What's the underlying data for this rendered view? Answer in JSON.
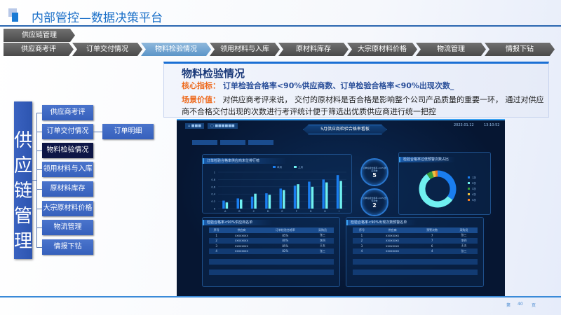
{
  "header": {
    "title": "内部管控—数据决策平台"
  },
  "breadcrumb": {
    "root": "供应链管理",
    "steps": [
      "供应商考评",
      "订单交付情况",
      "物料检验情况",
      "领用材料与入库",
      "原材料库存",
      "大宗原材料价格",
      "物流管理",
      "情报下钻"
    ],
    "active_index": 2
  },
  "info": {
    "heading": "物料检验情况",
    "core_label": "核心指标：",
    "core_text": "订单检验合格率<90%供应商数、订单检验合格率<90%出现次数_",
    "value_label": "场景价值：",
    "value_text": "对供应商考评来说， 交付的原材料是否合格是影响整个公司产品质量的重要一环， 通过对供应商不合格交付出现的次数进行考评统计便于筛选出优质供应商进行统一把控"
  },
  "tree": {
    "root": "供应链管理",
    "items": [
      "供应商考评",
      "订单交付情况",
      "物料检验情况",
      "领用材料与入库",
      "原材料库存",
      "大宗原材料价格",
      "物流管理",
      "情报下钻"
    ],
    "selected_index": 2,
    "child": "订单明细"
  },
  "dashboard": {
    "title": "5月供应商检验合格率看板",
    "date": "2023.01.12",
    "time": "13:10:52",
    "stat1": {
      "label": "订单检验合格率<90%供应商数",
      "value": "5"
    },
    "stat2": {
      "label": "订单检验合格率<90%出现次数",
      "value": "2"
    },
    "table1": {
      "title": "检验合格率<90%供应商名单",
      "headers": [
        "序号",
        "供应商",
        "订单检验合格率",
        "采购员"
      ],
      "rows": [
        [
          "1",
          "xxxxxxxx",
          "85%",
          "张三"
        ],
        [
          "2",
          "xxxxxxxx",
          "80%",
          "李四"
        ],
        [
          "3",
          "xxxxxxxx",
          "85%",
          "王五"
        ],
        [
          "4",
          "xxxxxxxx",
          "82%",
          "张三"
        ]
      ]
    },
    "table2": {
      "title": "检验合格率<90%出现次数预警名单",
      "headers": [
        "序号",
        "供应商",
        "预警次数",
        "采购员"
      ],
      "rows": [
        [
          "1",
          "xxxxxxxx",
          "7",
          "张三"
        ],
        [
          "2",
          "xxxxxxxx",
          "7",
          "李四"
        ],
        [
          "3",
          "xxxxxxxx",
          "6",
          "王五"
        ],
        [
          "4",
          "xxxxxxxx",
          "4",
          "张三"
        ]
      ]
    }
  },
  "chart_data": [
    {
      "type": "bar",
      "title": "订单检验合格率供应商末位排行榜",
      "categories": [
        "A",
        "B",
        "C",
        "D",
        "E",
        "F",
        "G",
        "H",
        "I"
      ],
      "series": [
        {
          "name": "本月",
          "color": "#1a7ef0",
          "values": [
            0.22,
            0.28,
            0.33,
            0.42,
            0.55,
            0.63,
            0.74,
            0.8,
            0.92
          ]
        },
        {
          "name": "上月",
          "color": "#6ff0f0",
          "values": [
            0.17,
            0.25,
            0.41,
            0.38,
            0.51,
            0.67,
            0.6,
            0.72,
            0.76
          ]
        }
      ],
      "yticks": [
        "0",
        "0.2",
        "0.4",
        "0.6",
        "0.8",
        "1"
      ],
      "ylim": [
        0,
        1
      ]
    },
    {
      "type": "pie",
      "title": "检验合格率过低预警次数占比",
      "labels": [
        "1次",
        "2次",
        "3次",
        "4次",
        "5次"
      ],
      "values": [
        35,
        55,
        5,
        3,
        2
      ],
      "colors": [
        "#1a7ef0",
        "#6ff0f0",
        "#3aa03a",
        "#f0c040",
        "#f07a20"
      ]
    }
  ],
  "footer": {
    "page_prefix": "第",
    "page": "40",
    "page_suffix": "页"
  }
}
